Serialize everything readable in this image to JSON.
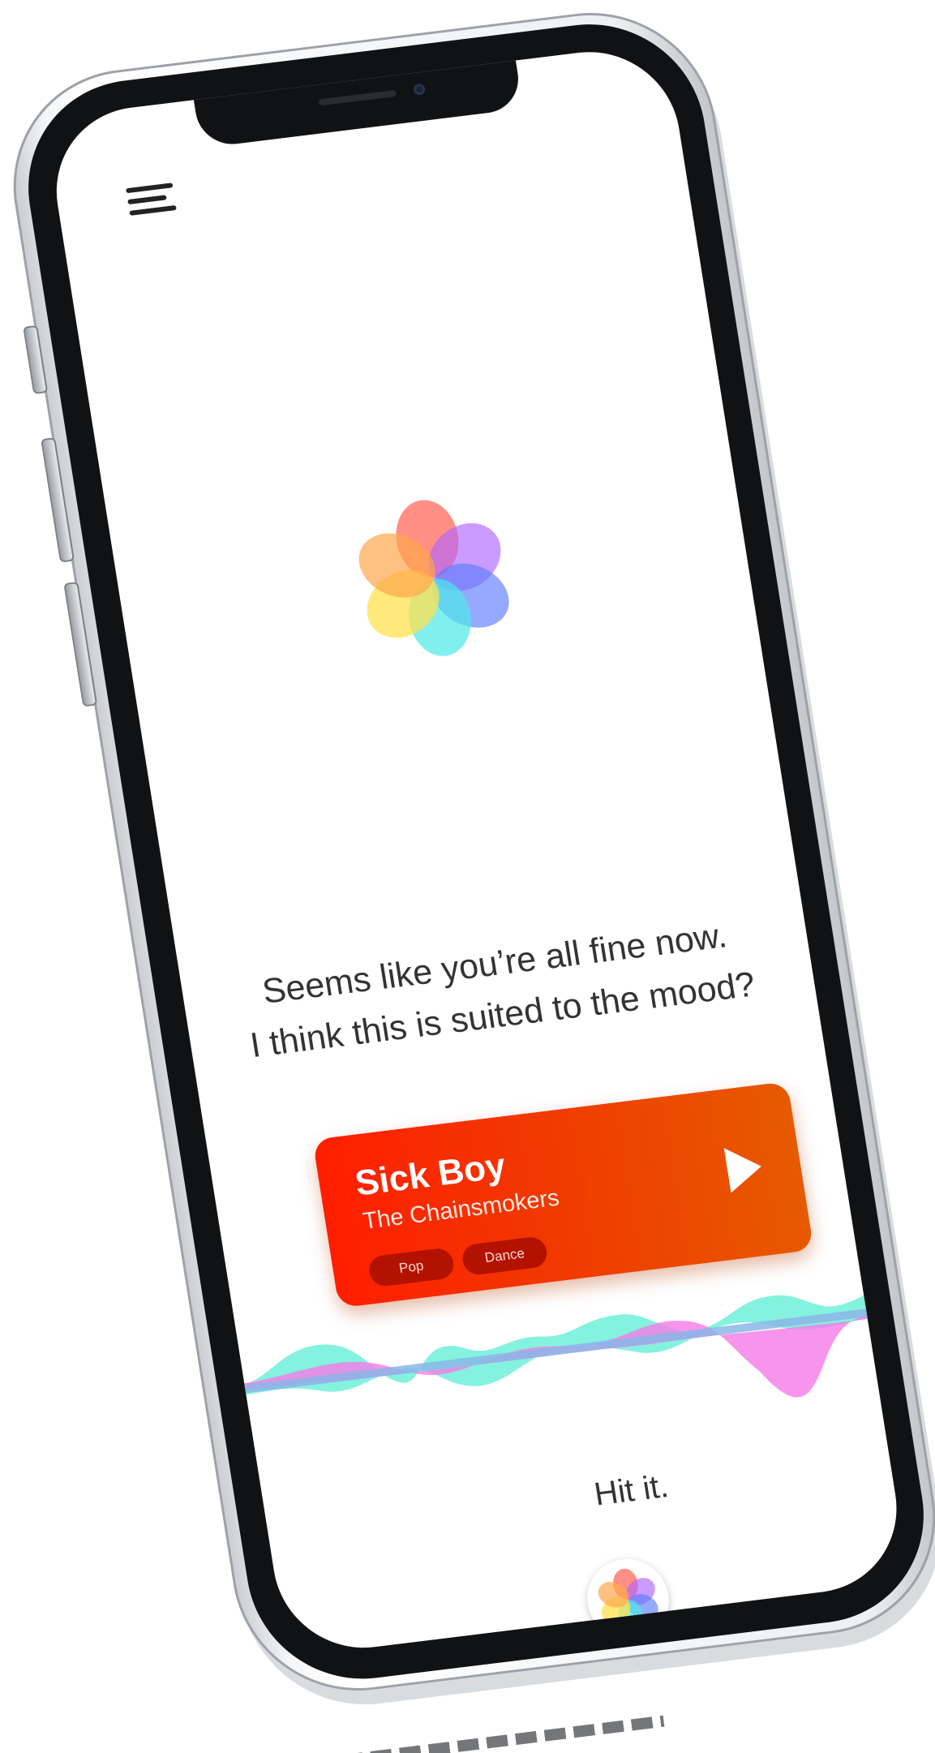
{
  "app": {
    "menu_icon": "hamburger-menu-icon",
    "logo_icon": "flower-petals-logo-icon"
  },
  "main": {
    "prompt_line_1": "Seems like you’re all fine now.",
    "prompt_line_2": "I think this is suited to the mood?",
    "hit_it": "Hit it."
  },
  "song_card": {
    "title": "Sick Boy",
    "artist": "The Chainsmokers",
    "tags": [
      "Pop",
      "Dance"
    ],
    "play_icon": "play-icon",
    "gradient_start": "#ff1e00",
    "gradient_end": "#e65a00",
    "tag_color": "#b31200"
  },
  "colors": {
    "petal_red": "#ff6a5c",
    "petal_orange": "#ffa64d",
    "petal_purple": "#b066ff",
    "petal_blue": "#5c7cff",
    "petal_yellow": "#ffe14d",
    "petal_cyan": "#4de8e8",
    "wave_cyan": "#6ef0d8",
    "wave_pink": "#f57ae8",
    "wave_blue": "#8bb6e8"
  }
}
